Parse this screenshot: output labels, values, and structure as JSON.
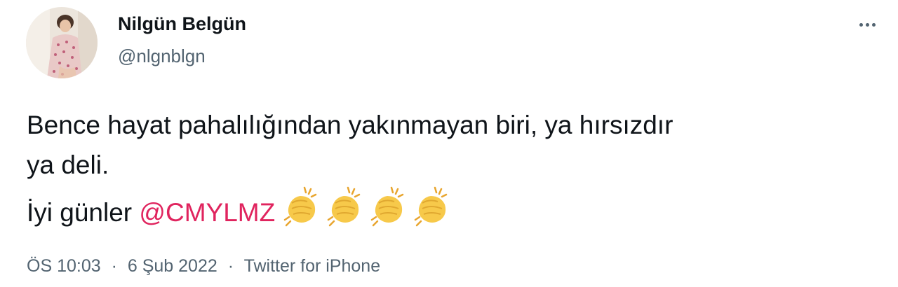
{
  "user": {
    "display_name": "Nilgün Belgün",
    "handle": "@nlgnblgn"
  },
  "tweet": {
    "line1": "Bence hayat pahalılığından yakınmayan biri, ya hırsızdır",
    "line2": "ya deli.",
    "line3_prefix": "İyi günler ",
    "mention": "@CMYLMZ",
    "emoji": "👏👏👏👏",
    "emoji_name": "clapping-hands"
  },
  "meta": {
    "time": "ÖS 10:03",
    "separator": "·",
    "date": "6 Şub 2022",
    "source": "Twitter for iPhone"
  },
  "colors": {
    "text": "#0f1419",
    "secondary": "#536471",
    "mention": "#e0245e"
  },
  "icons": {
    "more": "more-horizontal-icon",
    "avatar": "profile-photo"
  }
}
